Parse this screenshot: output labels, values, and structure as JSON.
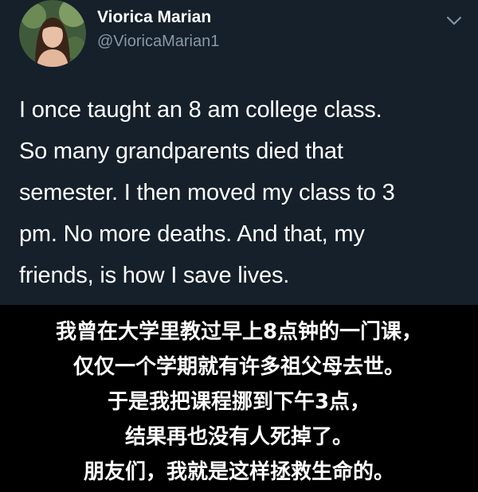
{
  "tweet": {
    "author": {
      "display_name": "Viorica Marian",
      "handle": "@VioricaMarian1",
      "avatar_icon": "profile-photo-avatar"
    },
    "menu_icon": "chevron-down-icon",
    "text_lines": [
      "I once taught an 8 am college class.",
      "So many grandparents died that",
      "semester. I then moved my class to 3",
      "pm. No more deaths. And that, my",
      "friends, is how I save lives."
    ]
  },
  "caption": {
    "lines": [
      "我曾在大学里教过早上8点钟的一门课，",
      "仅仅一个学期就有许多祖父母去世。",
      "于是我把课程挪到下午3点，",
      "结果再也没有人死掉了。",
      "朋友们，我就是这样拯救生命的。"
    ]
  },
  "colors": {
    "tweet_background": "#15202b",
    "caption_background": "#000000",
    "text_primary": "#ffffff",
    "text_secondary": "#8899a6"
  }
}
